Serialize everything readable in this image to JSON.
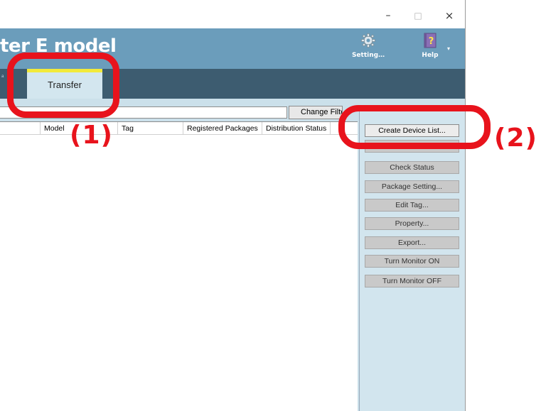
{
  "window": {
    "controls": {
      "minimize": "–",
      "maximize": "□",
      "close": "×"
    }
  },
  "header": {
    "app_title_visible": "ter E model",
    "setting": {
      "label": "Setting…",
      "icon": "gear-icon"
    },
    "help": {
      "label": "Help",
      "icon": "help-book-icon",
      "menu_arrow": "▾"
    },
    "background": "#6b9dbb"
  },
  "tabs": {
    "active": {
      "label": "Transfer",
      "indicator_color": "#f2ea3a"
    },
    "bar_color": "#3d5c70"
  },
  "filter": {
    "input_value": "",
    "change_filter_label": "Change Filter"
  },
  "table": {
    "columns": [
      "",
      "Model",
      "Tag",
      "Registered Packages",
      "Distribution Status"
    ],
    "rows": []
  },
  "side_panel": {
    "buttons": [
      {
        "label": "Create Device List...",
        "enabled": true
      },
      {
        "label": "",
        "enabled": false
      },
      {
        "label": "Check Status",
        "enabled": false
      },
      {
        "label": "Package Setting...",
        "enabled": false
      },
      {
        "label": "Edit Tag...",
        "enabled": false
      },
      {
        "label": "Property...",
        "enabled": false
      },
      {
        "label": "Export...",
        "enabled": false
      },
      {
        "label": "Turn Monitor ON",
        "enabled": false
      },
      {
        "label": "Turn Monitor OFF",
        "enabled": false
      }
    ]
  },
  "annotations": {
    "label_1": "(1)",
    "label_2": "(2)",
    "color": "#e8131c"
  }
}
